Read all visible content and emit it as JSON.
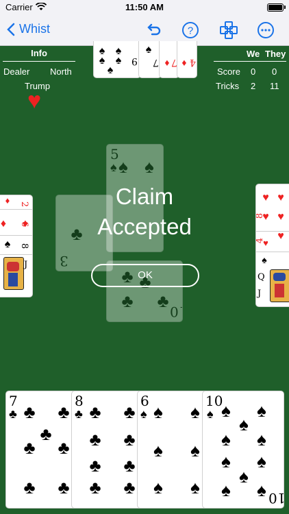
{
  "status": {
    "carrier": "Carrier",
    "time": "11:50 AM"
  },
  "nav": {
    "back_label": "Whist"
  },
  "info": {
    "title": "Info",
    "dealer_label": "Dealer",
    "dealer_value": "North",
    "trump_label": "Trump",
    "trump_suit": "♥"
  },
  "score": {
    "we_label": "We",
    "they_label": "They",
    "score_label": "Score",
    "score_we": "0",
    "score_they": "0",
    "tricks_label": "Tricks",
    "tricks_we": "2",
    "tricks_they": "11"
  },
  "dialog": {
    "title_line1": "Claim",
    "title_line2": "Accepted",
    "ok_label": "OK"
  },
  "hand": [
    {
      "rank": "7",
      "suit": "♣"
    },
    {
      "rank": "8",
      "suit": "♣"
    },
    {
      "rank": "6",
      "suit": "♠"
    },
    {
      "rank": "10",
      "suit": "♠"
    }
  ],
  "north_visible": [
    {
      "rank": "9",
      "suit": "♠"
    },
    {
      "rank": "7",
      "suit": "♦"
    },
    {
      "rank": "4",
      "suit": "♦"
    }
  ],
  "west_visible": [
    {
      "rank": "2",
      "suit": "♦"
    },
    {
      "rank": "6",
      "suit": "♦"
    },
    {
      "rank": "8",
      "suit": "♠"
    },
    {
      "rank": "J",
      "suit": "♠"
    }
  ],
  "east_visible": [
    {
      "rank": "8",
      "suit": "♥"
    },
    {
      "rank": "4",
      "suit": "♥"
    },
    {
      "rank": "Q",
      "suit": "♠"
    },
    {
      "rank": "J",
      "suit": "♠"
    }
  ],
  "trick": [
    {
      "rank": "5",
      "suit": "♠"
    },
    {
      "rank": "3",
      "suit": "♣"
    },
    {
      "rank": "10",
      "suit": "♣"
    }
  ]
}
